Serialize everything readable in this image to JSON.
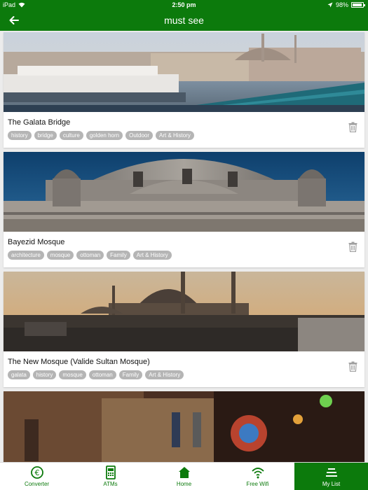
{
  "status": {
    "device": "iPad",
    "time": "2:50 pm",
    "battery": "98%"
  },
  "nav": {
    "title": "must see"
  },
  "cards": [
    {
      "name": "The Galata Bridge",
      "tags": [
        "history",
        "bridge",
        "culture",
        "golden horn",
        "Outdoor",
        "Art & History"
      ]
    },
    {
      "name": "Bayezid Mosque",
      "tags": [
        "architecture",
        "mosque",
        "ottoman",
        "Family",
        "Art & History"
      ]
    },
    {
      "name": "The New Mosque (Valide Sultan Mosque)",
      "tags": [
        "galata",
        "history",
        "mosque",
        "ottoman",
        "Family",
        "Art & History"
      ]
    },
    {
      "name": "",
      "tags": []
    }
  ],
  "tabs": [
    {
      "label": "Converter",
      "icon": "currency-icon"
    },
    {
      "label": "ATMs",
      "icon": "atm-icon"
    },
    {
      "label": "Home",
      "icon": "home-icon"
    },
    {
      "label": "Free Wifi",
      "icon": "wifi-icon"
    },
    {
      "label": "My List",
      "icon": "list-icon",
      "active": true
    }
  ],
  "colors": {
    "primary": "#0c7a0c",
    "tag": "#b5b5b5"
  }
}
